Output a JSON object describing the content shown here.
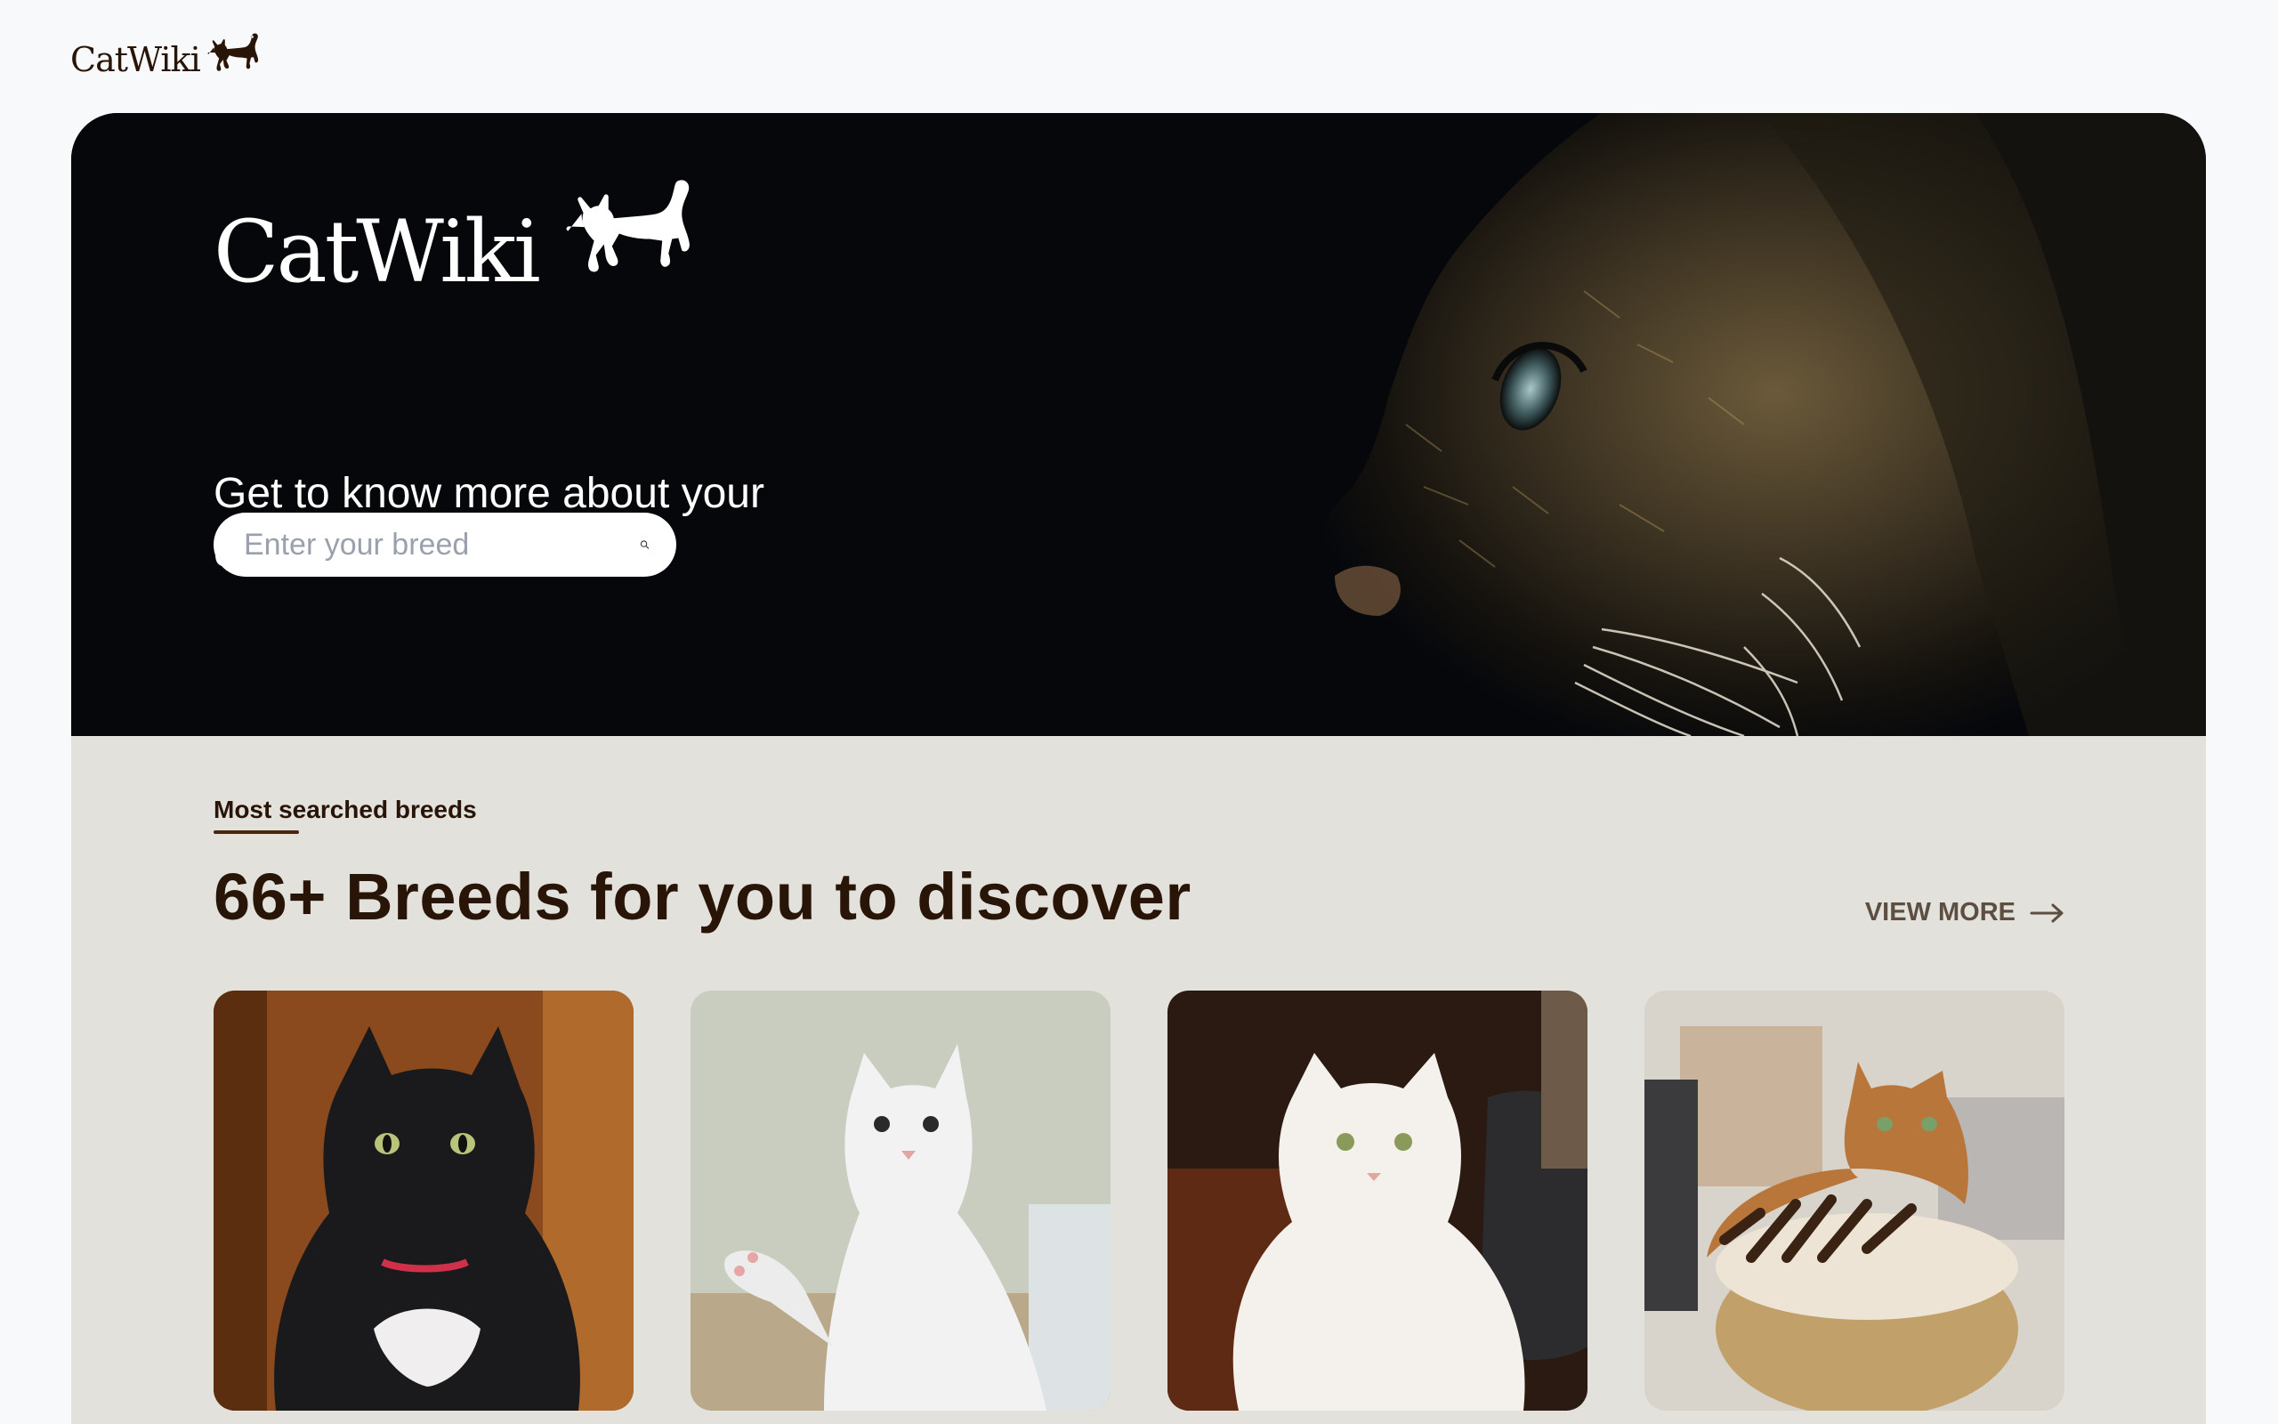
{
  "header": {
    "logo_text": "CatWiki",
    "logo_icon": "cat-silhouette-icon"
  },
  "hero": {
    "logo_text": "CatWiki",
    "tagline": "Get to know more about your cat breed",
    "search": {
      "placeholder": "Enter your breed",
      "value": "",
      "icon": "search-icon"
    }
  },
  "breeds_section": {
    "label": "Most searched breeds",
    "title": "66+ Breeds for you to discover",
    "view_more": "VIEW MORE",
    "view_more_icon": "arrow-right-icon",
    "cards": [
      {
        "image": "black-fluffy-cat-photo"
      },
      {
        "image": "white-cat-raising-paw-photo"
      },
      {
        "image": "white-longhair-cat-photo"
      },
      {
        "image": "tabby-cat-on-cat-bed-photo"
      }
    ]
  },
  "colors": {
    "brand_dark": "#291507",
    "hero_bg": "#05070b",
    "section_bg": "#e3e1dc",
    "page_bg": "#f8f9fb"
  }
}
